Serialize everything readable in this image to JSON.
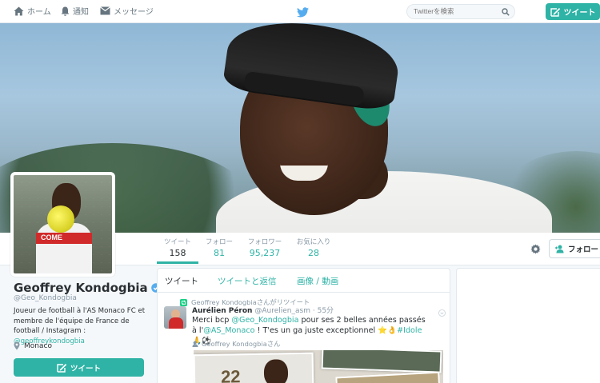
{
  "topbar": {
    "nav": [
      {
        "label": "ホーム",
        "icon": "home-icon"
      },
      {
        "label": "通知",
        "icon": "bell-icon"
      },
      {
        "label": "メッセージ",
        "icon": "envelope-icon"
      }
    ],
    "logo": "twitter-bird-icon",
    "search_placeholder": "Twitterを検索",
    "tweet_button": "ツイート"
  },
  "profile_nav": {
    "stats": [
      {
        "label": "ツイート",
        "value": "158"
      },
      {
        "label": "フォロー",
        "value": "81"
      },
      {
        "label": "フォロワー",
        "value": "95,237"
      },
      {
        "label": "お気に入り",
        "value": "28"
      }
    ],
    "follow_button": "フォロー"
  },
  "profile": {
    "name": "Geoffrey Kondogbia",
    "handle": "@Geo_Kondogbia",
    "bio_text": "Joueur de football à l'AS Monaco FC et membre de l'équipe de France de football / Instagram : ",
    "bio_link": "@geoffreykondogbia",
    "location": "Monaco",
    "tweet_button": "ツイート",
    "avatar_text": "COME"
  },
  "timeline": {
    "tabs": [
      "ツイート",
      "ツイートと返信",
      "画像 / 動画"
    ],
    "tweet": {
      "retweet_note": "Geoffrey Kondogbiaさんがリツイート",
      "author": "Aurélien Péron",
      "handle": "@Aurelien_asm",
      "time": "55分",
      "text_1": "Merci bcp ",
      "mention_1": "@Geo_Kondogbia",
      "text_2": " pour ses 2 belles années passés à l'",
      "mention_2": "@AS_Monaco",
      "text_3": " ! T'es un ga juste exceptionnel ⭐👌",
      "hashtag": "#Idole",
      "text_4": " 🙏⚽",
      "sub_note": "Geoffrey Kondogbiaさん",
      "media_number": "22"
    }
  },
  "colors": {
    "accent": "#2fb3a6",
    "text": "#292f33",
    "muted": "#8899a6",
    "border": "#e1e8ed"
  }
}
